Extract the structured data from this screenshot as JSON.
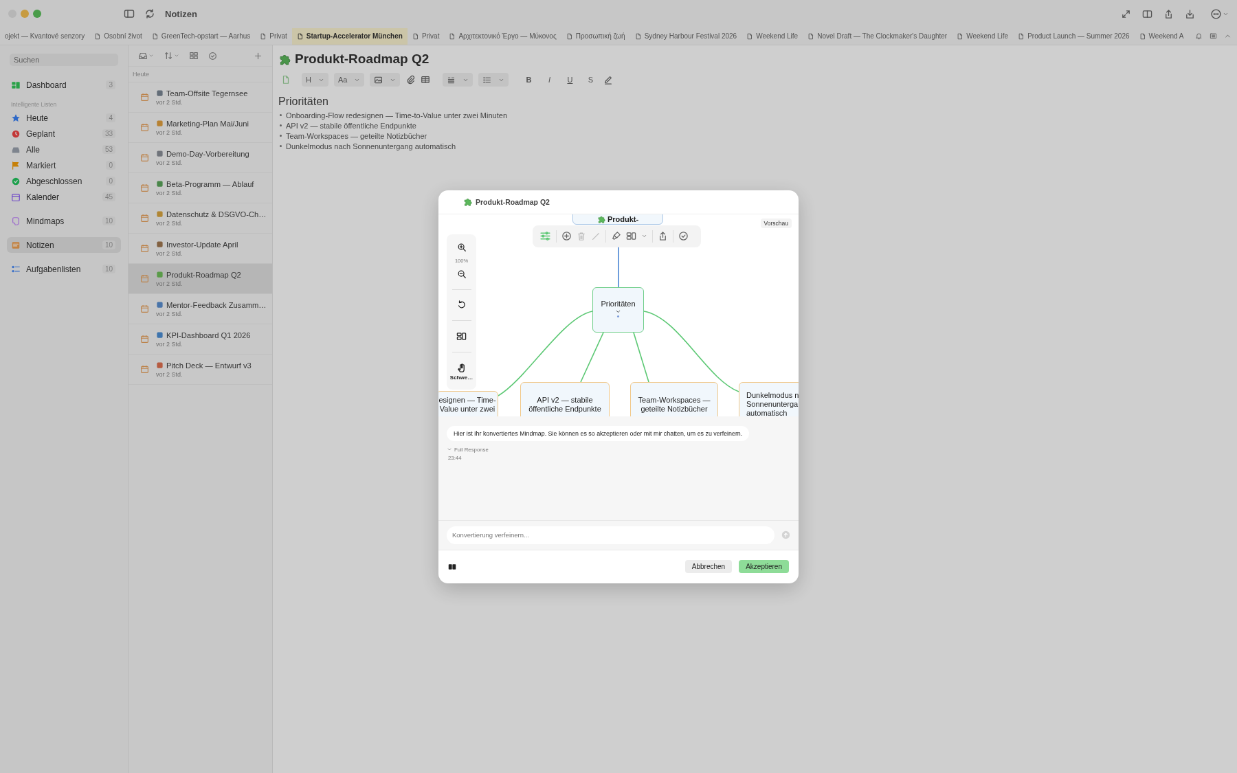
{
  "window": {
    "title": "Notizen"
  },
  "tabs": [
    {
      "label": "ojekt — Kvantové senzory",
      "selected": false
    },
    {
      "label": "Osobní život",
      "selected": false
    },
    {
      "label": "GreenTech-opstart — Aarhus",
      "selected": false
    },
    {
      "label": "Privat",
      "selected": false
    },
    {
      "label": "Startup-Accelerator München",
      "selected": true
    },
    {
      "label": "Privat",
      "selected": false
    },
    {
      "label": "Αρχιτεκτονικό Έργο — Μύκονος",
      "selected": false
    },
    {
      "label": "Προσωπική ζωή",
      "selected": false
    },
    {
      "label": "Sydney Harbour Festival 2026",
      "selected": false
    },
    {
      "label": "Weekend Life",
      "selected": false
    },
    {
      "label": "Novel Draft — The Clockmaker's Daughter",
      "selected": false
    },
    {
      "label": "Weekend Life",
      "selected": false
    },
    {
      "label": "Product Launch — Summer 2026",
      "selected": false
    },
    {
      "label": "Weekend A",
      "selected": false
    }
  ],
  "sidebar": {
    "search": {
      "placeholder": "Suchen"
    },
    "groups": [
      {
        "items": [
          {
            "label": "Dashboard",
            "count": "3",
            "color": "#2aa148",
            "selected": false
          }
        ]
      },
      {
        "title": "Intelligente Listen",
        "items": [
          {
            "label": "Heute",
            "count": "4",
            "color": "#3069c7",
            "selected": false
          },
          {
            "label": "Geplant",
            "count": "33",
            "color": "#c23737",
            "selected": false
          },
          {
            "label": "Alle",
            "count": "53",
            "color": "#7e848e",
            "selected": false
          },
          {
            "label": "Markiert",
            "count": "0",
            "color": "#c68009",
            "selected": false
          },
          {
            "label": "Abgeschlossen",
            "count": "0",
            "color": "#1ca04c",
            "selected": false
          },
          {
            "label": "Kalender",
            "count": "45",
            "color": "#714bc7",
            "selected": false
          }
        ]
      },
      {
        "items": [
          {
            "label": "Mindmaps",
            "count": "10",
            "color": "#9c6bcc",
            "selected": false
          }
        ]
      },
      {
        "items": [
          {
            "label": "Notizen",
            "count": "10",
            "color": "#c28241",
            "selected": true
          }
        ]
      },
      {
        "items": [
          {
            "label": "Aufgabenlisten",
            "count": "10",
            "color": "#3069c7",
            "selected": false
          }
        ]
      }
    ]
  },
  "note_list": {
    "section": "Heute",
    "notes": [
      {
        "title": "Team-Offsite Tegernsee",
        "time": "vor 2 Std.",
        "selected": false
      },
      {
        "title": "Marketing-Plan Mai/Juni",
        "time": "vor 2 Std.",
        "selected": false
      },
      {
        "title": "Demo-Day-Vorbereitung",
        "time": "vor 2 Std.",
        "selected": false
      },
      {
        "title": "Beta-Programm — Ablauf",
        "time": "vor 2 Std.",
        "selected": false
      },
      {
        "title": "Datenschutz & DSGVO-Ch…",
        "time": "vor 2 Std.",
        "selected": false
      },
      {
        "title": "Investor-Update April",
        "time": "vor 2 Std.",
        "selected": false
      },
      {
        "title": "Produkt-Roadmap Q2",
        "time": "vor 2 Std.",
        "selected": true
      },
      {
        "title": "Mentor-Feedback Zusamm…",
        "time": "vor 2 Std.",
        "selected": false
      },
      {
        "title": "KPI-Dashboard Q1 2026",
        "time": "vor 2 Std.",
        "selected": false
      },
      {
        "title": "Pitch Deck — Entwurf v3",
        "time": "vor 2 Std.",
        "selected": false
      }
    ]
  },
  "editor": {
    "title": "Produkt-Roadmap Q2",
    "toolbar": [
      {
        "kind": "doc"
      },
      {
        "kind": "dropdown",
        "label": "H"
      },
      {
        "kind": "dropdown",
        "label": "Aa"
      },
      {
        "kind": "image"
      },
      {
        "kind": "attach"
      },
      {
        "kind": "table"
      },
      {
        "kind": "align"
      },
      {
        "kind": "list"
      },
      {
        "kind": "format",
        "label": "B"
      },
      {
        "kind": "format",
        "label": "I"
      },
      {
        "kind": "format",
        "label": "U"
      },
      {
        "kind": "format",
        "label": "S"
      },
      {
        "kind": "highlight"
      }
    ],
    "heading": "Prioritäten",
    "bullets": [
      "Onboarding-Flow redesignen — Time-to-Value unter zwei Minuten",
      "API v2 — stabile öffentliche Endpunkte",
      "Team-Workspaces — geteilte Notizbücher",
      "Dunkelmodus nach Sonnenuntergang automatisch"
    ]
  },
  "dialog": {
    "title": "Produkt-Roadmap Q2",
    "badge": "Vorschau",
    "zoom": "100%",
    "tool_label": "Schwe…",
    "root_node": "Produkt-",
    "center_node": "Prioritäten",
    "child_nodes": [
      {
        "lines": [
          "esignen — Time-",
          "Value unter zwei"
        ]
      },
      {
        "lines": [
          "API v2 — stabile",
          "öffentliche Endpunkte"
        ]
      },
      {
        "lines": [
          "Team-Workspaces —",
          "geteilte Notizbücher"
        ]
      },
      {
        "lines": [
          "Dunkelmodus n",
          "Sonnenunterga",
          "automatisch"
        ]
      }
    ],
    "message": "Hier ist Ihr konvertiertes Mindmap. Sie können es so akzeptieren oder mit mir chatten, um es zu verfeinern.",
    "full_response": "Full Response",
    "time": "23:44",
    "input": {
      "placeholder": "Konvertierung verfeinern..."
    },
    "buttons": [
      {
        "label": "Abbrechen",
        "primary": false
      },
      {
        "label": "Akzeptieren",
        "primary": true
      }
    ]
  }
}
